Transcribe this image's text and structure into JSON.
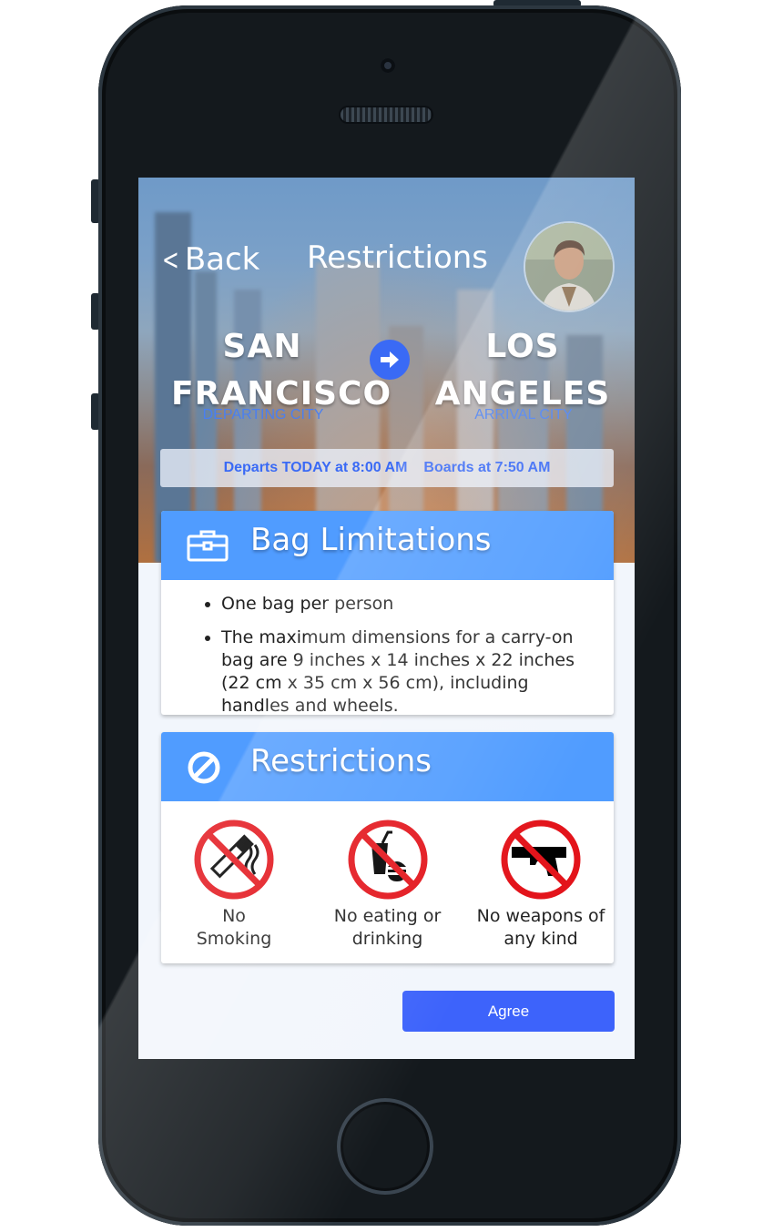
{
  "nav": {
    "back_label": "Back",
    "title": "Restrictions"
  },
  "flight": {
    "departing": {
      "city_line1": "SAN",
      "city_line2": "FRANCISCO",
      "label": "DEPARTING CITY"
    },
    "arrival": {
      "city_line1": "LOS",
      "city_line2": "ANGELES",
      "label": "ARRIVAL CITY"
    },
    "departs": "Departs TODAY at 8:00 AM",
    "boards": "Boards at 7:50 AM"
  },
  "bag_card": {
    "title": "Bag Limitations",
    "icon": "briefcase-icon",
    "items": [
      "One bag per person",
      "The maximum dimensions for a carry-on bag are 9 inches x 14 inches x 22 inches (22 cm x 35 cm x 56 cm), including handles and wheels."
    ]
  },
  "restrictions_card": {
    "title": "Restrictions",
    "icon": "prohibited-icon",
    "items": [
      {
        "line1": "No",
        "line2": "Smoking",
        "icon": "no-smoking-icon"
      },
      {
        "line1": "No eating or",
        "line2": "drinking",
        "icon": "no-food-drink-icon"
      },
      {
        "line1": "No weapons of",
        "line2": "any kind",
        "icon": "no-weapons-icon"
      }
    ]
  },
  "agree_label": "Agree",
  "colors": {
    "accent": "#3d63fb",
    "card_header": "#509cff",
    "prohibit_red": "#e3141b",
    "label_blue": "#4a7ff0"
  }
}
